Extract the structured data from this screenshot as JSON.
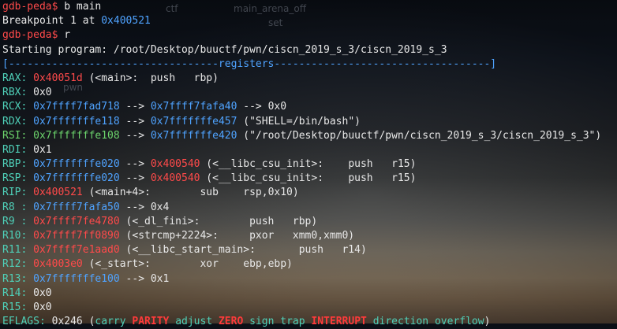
{
  "background_labels": [
    "ctf",
    "main_arena_off",
    "set",
    "pwn"
  ],
  "lines": [
    {
      "prompt": "gdb-peda$ ",
      "text": "b main"
    },
    {
      "text": "Breakpoint 1 at ",
      "addr": "0x400521"
    },
    {
      "prompt": "gdb-peda$ ",
      "text": "r"
    },
    {
      "text": "Starting program: /root/Desktop/buuctf/pwn/ciscn_2019_s_3/ciscn_2019_s_3"
    },
    {
      "separator": "[----------------------------------registers-----------------------------------]"
    }
  ],
  "registers": [
    {
      "name": "RAX:",
      "v1": "0x40051d",
      "c1": "red",
      "rest": " (<main>:  push   rbp)"
    },
    {
      "name": "RBX:",
      "v1": "",
      "c1": "",
      "rest": " 0x0"
    },
    {
      "name": "RCX:",
      "v1": "0x7ffff7fad718",
      "c1": "blue",
      "mid": " --> ",
      "v2": "0x7ffff7fafa40",
      "c2": "blue",
      "rest": " --> 0x0"
    },
    {
      "name": "RDX:",
      "v1": "0x7fffffffe118",
      "c1": "blue",
      "mid": " --> ",
      "v2": "0x7fffffffe457",
      "c2": "blue",
      "rest": " (\"SHELL=/bin/bash\")"
    },
    {
      "name": "RSI:",
      "v1": "0x7fffffffe108",
      "c1": "green",
      "namecolor": "green",
      "mid": " --> ",
      "v2": "0x7fffffffe420",
      "c2": "blue",
      "rest": " (\"/root/Desktop/buuctf/pwn/ciscn_2019_s_3/ciscn_2019_s_3\")"
    },
    {
      "name": "RDI:",
      "v1": "",
      "c1": "",
      "rest": " 0x1"
    },
    {
      "name": "RBP:",
      "v1": "0x7fffffffe020",
      "c1": "blue",
      "mid": " --> ",
      "v2": "0x400540",
      "c2": "red",
      "rest": " (<__libc_csu_init>:    push   r15)"
    },
    {
      "name": "RSP:",
      "v1": "0x7fffffffe020",
      "c1": "blue",
      "mid": " --> ",
      "v2": "0x400540",
      "c2": "red",
      "rest": " (<__libc_csu_init>:    push   r15)"
    },
    {
      "name": "RIP:",
      "v1": "0x400521",
      "c1": "red",
      "rest": " (<main+4>:        sub    rsp,0x10)"
    },
    {
      "name": "R8 :",
      "v1": "0x7ffff7fafa50",
      "c1": "blue",
      "rest": " --> 0x4"
    },
    {
      "name": "R9 :",
      "v1": "0x7ffff7fe4780",
      "c1": "red",
      "rest": " (<_dl_fini>:        push   rbp)"
    },
    {
      "name": "R10:",
      "v1": "0x7ffff7ff0890",
      "c1": "red",
      "rest": " (<strcmp+2224>:     pxor   xmm0,xmm0)"
    },
    {
      "name": "R11:",
      "v1": "0x7ffff7e1aad0",
      "c1": "red",
      "rest": " (<__libc_start_main>:       push   r14)"
    },
    {
      "name": "R12:",
      "v1": "0x4003e0",
      "c1": "red",
      "rest": " (<_start>:        xor    ebp,ebp)"
    },
    {
      "name": "R13:",
      "v1": "0x7fffffffe100",
      "c1": "blue",
      "rest": " --> 0x1"
    },
    {
      "name": "R14:",
      "v1": "",
      "c1": "",
      "rest": " 0x0"
    },
    {
      "name": "R15:",
      "v1": "",
      "c1": "",
      "rest": " 0x0"
    }
  ],
  "eflags": {
    "label": "EFLAGS:",
    "value": " 0x246 (",
    "flags": [
      {
        "t": "carry",
        "c": "teal"
      },
      {
        "t": " ",
        "c": ""
      },
      {
        "t": "PARITY",
        "c": "bold-red"
      },
      {
        "t": " ",
        "c": ""
      },
      {
        "t": "adjust",
        "c": "teal"
      },
      {
        "t": " ",
        "c": ""
      },
      {
        "t": "ZERO",
        "c": "bold-red"
      },
      {
        "t": " ",
        "c": ""
      },
      {
        "t": "sign",
        "c": "teal"
      },
      {
        "t": " ",
        "c": ""
      },
      {
        "t": "trap",
        "c": "teal"
      },
      {
        "t": " ",
        "c": ""
      },
      {
        "t": "INTERRUPT",
        "c": "bold-red"
      },
      {
        "t": " ",
        "c": ""
      },
      {
        "t": "direction",
        "c": "teal"
      },
      {
        "t": " ",
        "c": ""
      },
      {
        "t": "overflow",
        "c": "teal"
      }
    ],
    "close": ")"
  },
  "colors": {
    "blue": "#4fa3ff",
    "red": "#ff4a4a",
    "green": "#6cd46c",
    "teal": "#4fd0b8"
  }
}
